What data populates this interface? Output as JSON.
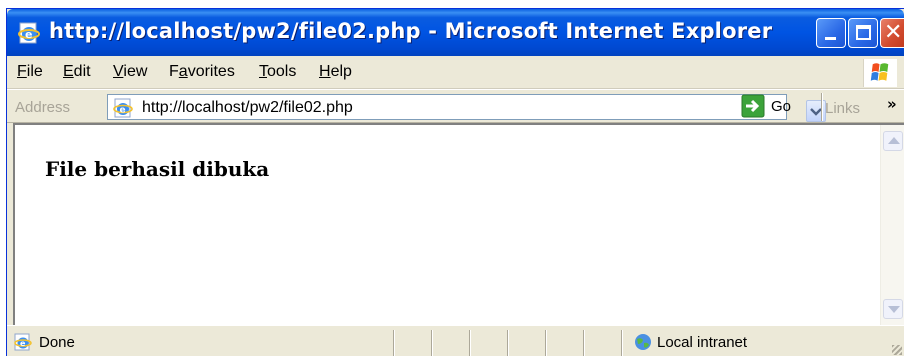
{
  "window": {
    "title": "http://localhost/pw2/file02.php - Microsoft Internet Explorer"
  },
  "menubar": {
    "items": [
      {
        "first": "F",
        "rest": "ile"
      },
      {
        "first": "E",
        "rest": "dit"
      },
      {
        "first": "V",
        "rest": "iew"
      },
      {
        "pre": "F",
        "first": "a",
        "rest": "vorites"
      },
      {
        "first": "T",
        "rest": "ools"
      },
      {
        "first": "H",
        "rest": "elp"
      }
    ]
  },
  "addressbar": {
    "label": "Address",
    "url": "http://localhost/pw2/file02.php",
    "go_label": "Go",
    "links_label": "Links",
    "links_chevron": "»"
  },
  "content": {
    "heading": "File berhasil dibuka"
  },
  "statusbar": {
    "status": "Done",
    "zone": "Local intranet"
  },
  "colors": {
    "titlebar": "#0054e3",
    "close_button": "#d24b2e",
    "chrome": "#ece9d8"
  }
}
